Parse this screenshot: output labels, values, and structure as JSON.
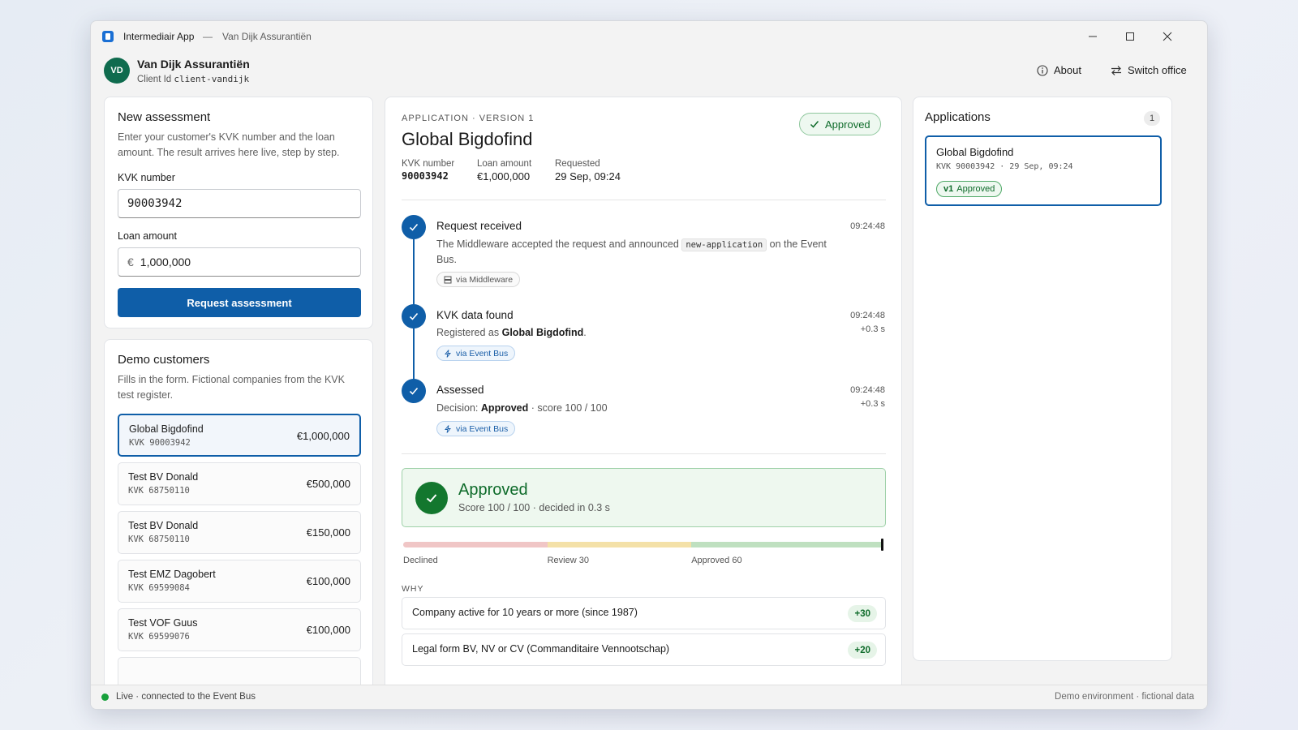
{
  "window": {
    "app_name": "Intermediair App",
    "separator": "—",
    "office_subtitle": "Van Dijk Assurantiën"
  },
  "header": {
    "avatar_initials": "VD",
    "office_name": "Van Dijk Assurantiën",
    "client_id_label": "Client Id",
    "client_id_value": "client-vandijk",
    "about_label": "About",
    "switch_office_label": "Switch office"
  },
  "new_assessment": {
    "title": "New assessment",
    "description": "Enter your customer's KVK number and the loan amount. The result arrives here live, step by step.",
    "kvk_label": "KVK number",
    "kvk_value": "90003942",
    "loan_label": "Loan amount",
    "currency_symbol": "€",
    "loan_value": "1,000,000",
    "submit_label": "Request assessment"
  },
  "demo_customers": {
    "title": "Demo customers",
    "description": "Fills in the form. Fictional companies from the KVK test register.",
    "items": [
      {
        "name": "Global Bigdofind",
        "kvk": "KVK 90003942",
        "amount": "€1,000,000"
      },
      {
        "name": "Test BV Donald",
        "kvk": "KVK 68750110",
        "amount": "€500,000"
      },
      {
        "name": "Test BV Donald",
        "kvk": "KVK 68750110",
        "amount": "€150,000"
      },
      {
        "name": "Test EMZ Dagobert",
        "kvk": "KVK 69599084",
        "amount": "€100,000"
      },
      {
        "name": "Test VOF Guus",
        "kvk": "KVK 69599076",
        "amount": "€100,000"
      }
    ]
  },
  "application": {
    "overline": "APPLICATION · VERSION 1",
    "title": "Global Bigdofind",
    "status_badge": "Approved",
    "meta": {
      "kvk_label": "KVK number",
      "kvk_value": "90003942",
      "loan_label": "Loan amount",
      "loan_value": "€1,000,000",
      "requested_label": "Requested",
      "requested_value": "29 Sep, 09:24"
    },
    "steps": [
      {
        "title": "Request received",
        "desc_before": "The Middleware accepted the request and announced",
        "desc_code": "new-application",
        "desc_after": "on the Event Bus.",
        "time": "09:24:48",
        "delta": "",
        "pill": "via Middleware"
      },
      {
        "title": "KVK data found",
        "desc_before": "Registered as",
        "desc_strong": "Global Bigdofind",
        "desc_after": ".",
        "time": "09:24:48",
        "delta": "+0.3 s",
        "pill": "via Event Bus"
      },
      {
        "title": "Assessed",
        "desc_before": "Decision:",
        "desc_strong": "Approved",
        "desc_after": "· score 100 / 100",
        "time": "09:24:48",
        "delta": "+0.3 s",
        "pill": "via Event Bus"
      }
    ],
    "result": {
      "title": "Approved",
      "subtitle": "Score 100 / 100 · decided in 0.3 s"
    },
    "scale": {
      "score": 100,
      "declined_label": "Declined",
      "review_label": "Review 30",
      "approved_label": "Approved 60",
      "colors": {
        "declined": "#f0c6c6",
        "review": "#f4e1a8",
        "approved": "#bfe0c0"
      }
    },
    "why_title": "WHY",
    "reasons": [
      {
        "text": "Company active for 10 years or more (since 1987)",
        "points": "+30"
      },
      {
        "text": "Legal form BV, NV or CV (Commanditaire Vennootschap)",
        "points": "+20"
      }
    ]
  },
  "applications_panel": {
    "title": "Applications",
    "count": "1",
    "items": [
      {
        "name": "Global Bigdofind",
        "meta": "KVK 90003942 · 29 Sep, 09:24",
        "version": "v1",
        "status": "Approved"
      }
    ]
  },
  "footer": {
    "status": "Live · connected to the Event Bus",
    "environment": "Demo environment · fictional data"
  },
  "colors": {
    "primary": "#0f5ea8",
    "success": "#13772e",
    "avatar": "#0f6b4e"
  }
}
